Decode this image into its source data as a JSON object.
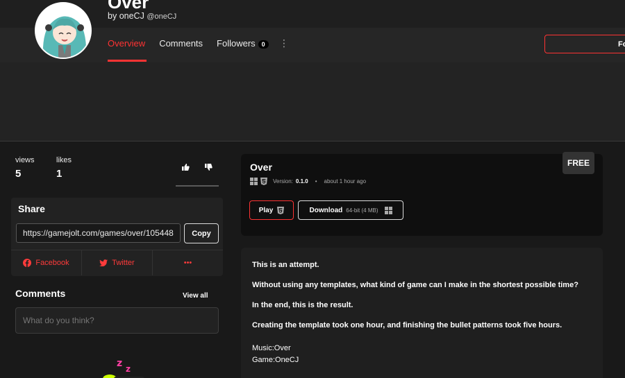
{
  "header": {
    "game_title": "Over",
    "by_prefix": "by",
    "author_name": "oneCJ",
    "author_handle": "@oneCJ",
    "follow_label": "Fo"
  },
  "nav": {
    "overview": "Overview",
    "comments": "Comments",
    "followers": "Followers",
    "followers_count": "0",
    "more": "⋮"
  },
  "stats": {
    "views_label": "views",
    "views_value": "5",
    "likes_label": "likes",
    "likes_value": "1"
  },
  "share": {
    "title": "Share",
    "url": "https://gamejolt.com/games/over/105448",
    "copy_label": "Copy",
    "facebook": "Facebook",
    "twitter": "Twitter",
    "more": "•••"
  },
  "comments": {
    "title": "Comments",
    "view_all": "View all",
    "placeholder": "What do you think?"
  },
  "game_card": {
    "title": "Over",
    "version_label": "Version:",
    "version": "0.1.0",
    "updated": "about 1 hour ago",
    "price_badge": "FREE",
    "play_label": "Play",
    "download_label": "Download",
    "download_info": "64-bit (4 MB)"
  },
  "description": {
    "paragraphs": [
      "This is an attempt.",
      "Without using any templates, what kind of game can I make in the shortest possible time?",
      "In the end, this is the result.",
      "Creating the template took one hour, and finishing the bullet patterns took five hours."
    ],
    "credits": [
      "Music:Over",
      "Game:OneCJ"
    ]
  },
  "colors": {
    "accent": "#ff3333",
    "background": "#191919",
    "card": "#0f0f0f"
  }
}
